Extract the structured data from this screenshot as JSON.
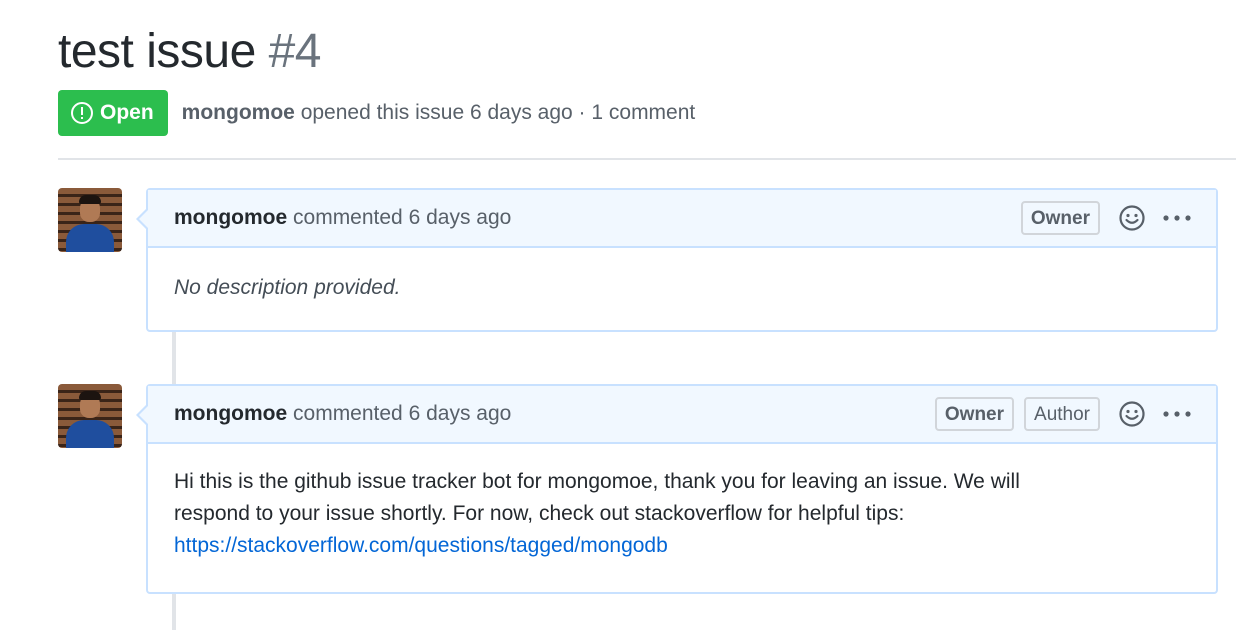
{
  "issue": {
    "title": "test issue",
    "number": "#4",
    "state": "Open",
    "author": "mongomoe",
    "opened_text": "opened this issue 6 days ago · 1 comment"
  },
  "comments": [
    {
      "author": "mongomoe",
      "meta": "commented 6 days ago",
      "labels": [
        "Owner"
      ],
      "body": "No description provided."
    },
    {
      "author": "mongomoe",
      "meta": "commented 6 days ago",
      "labels": [
        "Owner",
        "Author"
      ],
      "body_line1": "Hi this is the github issue tracker bot for mongomoe, thank you for leaving an issue. We will",
      "body_line2": "respond to your issue shortly. For now, check out stackoverflow for helpful tips:",
      "link": "https://stackoverflow.com/questions/tagged/mongodb"
    }
  ],
  "colors": {
    "open_green": "#2cbe4e",
    "header_bg": "#f1f8ff",
    "border_blue": "#c8e1ff",
    "link": "#0366d6"
  }
}
